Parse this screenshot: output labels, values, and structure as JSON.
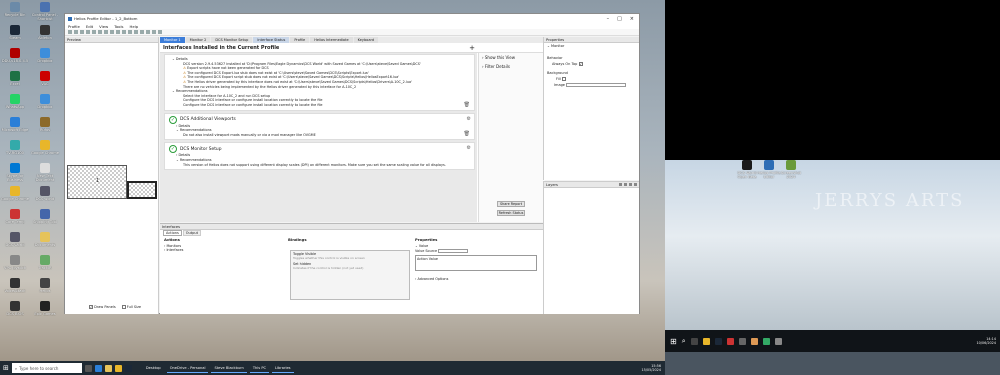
{
  "desktop_left": {
    "icons": [
      {
        "label": "Recycle Bin",
        "color": "#6b8aa8"
      },
      {
        "label": "Control Panel - Shortcut",
        "color": "#4a72b0"
      },
      {
        "label": "Steam",
        "color": "#1b2838"
      },
      {
        "label": "Ableton",
        "color": "#333"
      },
      {
        "label": "DDU-v18.0.4.5",
        "color": "#b00000"
      },
      {
        "label": "Dropbox",
        "color": "#3d8edb"
      },
      {
        "label": "Excel",
        "color": "#1e7145"
      },
      {
        "label": "VAC",
        "color": "#c00"
      },
      {
        "label": "WhatsApp",
        "color": "#25d366"
      },
      {
        "label": "Dropbox",
        "color": "#3d8edb"
      },
      {
        "label": "Microsoft Edge",
        "color": "#2b7fd8"
      },
      {
        "label": "Rufus",
        "color": "#8c6a2a"
      },
      {
        "label": "TV-RG100",
        "color": "#3aa"
      },
      {
        "label": "Google Chrome",
        "color": "#e8b62a"
      },
      {
        "label": "Skype for Business",
        "color": "#0078d4"
      },
      {
        "label": "New Text Document",
        "color": "#ddd"
      },
      {
        "label": "Google Chrome",
        "color": "#e8b62a"
      },
      {
        "label": "DCS world",
        "color": "#556"
      },
      {
        "label": "Core Temp",
        "color": "#c33"
      },
      {
        "label": "Snipping Tool",
        "color": "#46a"
      },
      {
        "label": "DCS-World",
        "color": "#556"
      },
      {
        "label": "Documents",
        "color": "#e6c35a"
      },
      {
        "label": "VPC Joystick",
        "color": "#888"
      },
      {
        "label": "TrackIR",
        "color": "#6a6"
      },
      {
        "label": "VoiceAttack",
        "color": "#333"
      },
      {
        "label": "Helios",
        "color": "#444"
      },
      {
        "label": "DCS BIOS",
        "color": "#333"
      },
      {
        "label": "Epic Games",
        "color": "#222"
      }
    ]
  },
  "desktop_right": {
    "icons": [
      {
        "label": "DCS World Open Beta",
        "color": "#1a1a1a"
      },
      {
        "label": "Helios Profile Editor",
        "color": "#2d6db5"
      },
      {
        "label": "Screenshot 2024",
        "color": "#6a9a3a"
      }
    ],
    "watermark": "JERRYS ARTS"
  },
  "taskbar_left": {
    "search_placeholder": "Type here to search",
    "apps": [
      "OneDrive - Personal",
      "Steve Blackburn",
      "This PC",
      "Libraries"
    ],
    "desktop_label": "Desktop",
    "time": "15:56",
    "date": "15/05/2024"
  },
  "taskbar_right": {
    "time": "14:14",
    "date": "10/06/2024"
  },
  "window": {
    "title": "Helios Profile Editor - 1_2_Bottom",
    "menu": [
      "Profile",
      "Edit",
      "View",
      "Tools",
      "Help"
    ],
    "preview": {
      "title": "Preview",
      "checkbox_draw_panels": "Draw Panels",
      "checkbox_full_size": "Full Size",
      "monitor_number": "1"
    },
    "tabs": [
      "Monitor 1",
      "Monitor 2",
      "DCS Monitor Setup",
      "Interface Status",
      "Profile",
      "Helios Intermediate",
      "Keyboard"
    ],
    "interfaces": {
      "heading": "Interfaces Installed in the Current Profile",
      "card1": {
        "details_label": "Details",
        "lines": [
          "DCS version 2.9.4.53627 installed at 'D:\\Program Files\\Eagle Dynamics\\DCS World' with Saved Games at 'C:\\Users\\steve\\Saved Games\\DCS'",
          "Export scripts have not been generated for DCS",
          "The configured DCS Export.lua stub does not exist at 'C:\\Users\\steve\\Saved Games\\DCS\\Scripts\\Export.lua'",
          "The configured DCS Export script stub does not exist at 'C:\\Users\\steve\\Saved Games\\DCS\\Scripts\\Helios\\HeliosExport16.lua'",
          "The Helios driver generated by this interface does not exist at 'C:\\Users\\steve\\Saved Games\\DCS\\Scripts\\Helios\\Drivers\\A-10C_2.lua'",
          "There are no vehicles being implemented by the Helios driver generated by this interface for A-10C_2"
        ],
        "recommendations_label": "Recommendations",
        "recs": [
          "Select the interface for A-10C_2 and run DCS setup",
          "Configure the DCS interface or configure install location correctly to locate the file",
          "Configure the DCS interface or configure install location correctly to locate the file"
        ]
      },
      "card2": {
        "title": "DCS Additional Viewports",
        "details_label": "Details",
        "recommendations_label": "Recommendations",
        "recs": [
          "Do not also install viewport mods manually or via a mod manager like OVGME"
        ]
      },
      "card3": {
        "title": "DCS Monitor Setup",
        "details_label": "Details",
        "recommendations_label": "Recommendations",
        "recs": [
          "This version of Helios does not support using different display scales (DPI) on different monitors. Make sure you set the same scaling value for all displays."
        ]
      },
      "side": {
        "show_this_view": "Show this View",
        "filter_details": "Filter Details",
        "share_report": "Share Report",
        "refresh_button": "Refresh Status"
      }
    },
    "properties": {
      "title": "Properties",
      "section": "Monitor",
      "behavior": "Behavior",
      "always_on_top": "Always On Top",
      "background": "Background",
      "fill": "Fill",
      "image": "Image",
      "layers_title": "Layers"
    },
    "interfaces_panel": {
      "title": "Interfaces",
      "subtabs": [
        "Actions",
        "Output"
      ],
      "col_actions": "Actions",
      "col_bindings": "Bindings",
      "col_properties": "Properties",
      "tree": [
        "Monitors",
        "Interfaces"
      ],
      "binding1_title": "Toggle Visible",
      "binding1_desc": "Toggles whether this control is visible on screen",
      "binding2_title": "Set hidden",
      "binding2_desc": "Indicates if the control is hidden (not yet used)",
      "value_label": "Value",
      "value_source_label": "Value Source",
      "action_value_label": "Action Value",
      "advanced_options": "Advanced Options"
    }
  }
}
